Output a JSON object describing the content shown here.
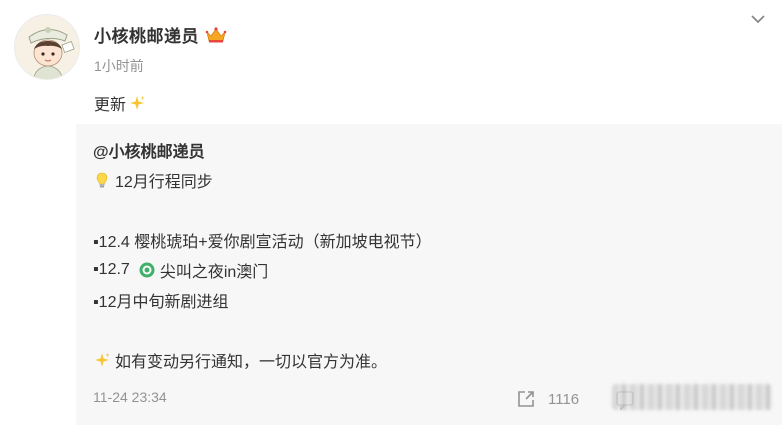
{
  "post": {
    "author": "小核桃邮递员",
    "time": "1小时前",
    "text": "更新",
    "icons": {
      "avatar": "cartoon-postman-avatar",
      "verified": "crown-icon",
      "sparkle": "sparkle-icon",
      "more": "chevron-down-icon"
    }
  },
  "repost": {
    "author": "@小核桃邮递员",
    "line1": "12月行程同步",
    "line2": "▪12.4  樱桃琥珀+爱你剧宣活动（新加坡电视节）",
    "line3_prefix": "▪12.7",
    "line3_text": "尖叫之夜in澳门",
    "line4": "▪12月中旬新剧进组",
    "line5": "如有变动另行通知，一切以官方为准。",
    "time": "11-24 23:34",
    "share_count": "1116"
  },
  "colors": {
    "repost_bg": "#f7f7f7",
    "muted": "#939393",
    "text": "#333333",
    "crown": "#f5a623"
  }
}
